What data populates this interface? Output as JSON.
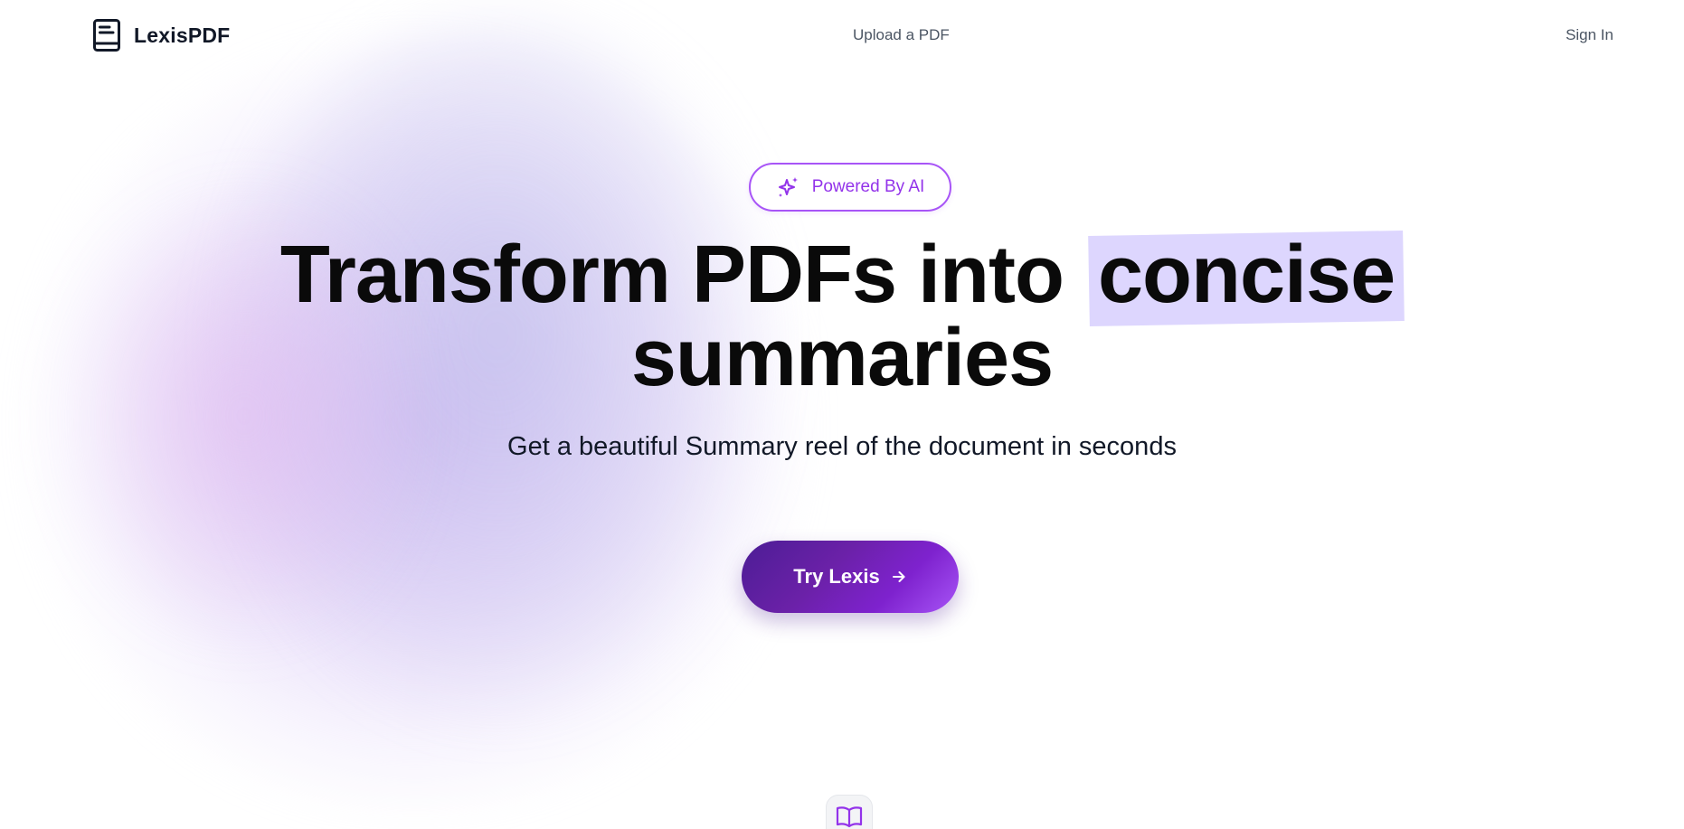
{
  "brand": {
    "name": "LexisPDF",
    "icon": "document-icon"
  },
  "nav": {
    "upload_label": "Upload a PDF",
    "signin_label": "Sign In"
  },
  "hero": {
    "badge_label": "Powered By AI",
    "badge_icon": "sparkles-icon",
    "headline_part1": "Transform PDFs into",
    "headline_highlight": "concise",
    "headline_part2": "summaries",
    "subtitle": "Get a beautiful Summary reel of the document in seconds",
    "cta_label": "Try Lexis",
    "cta_icon": "arrow-right-icon"
  },
  "footer_tile": {
    "icon": "book-open-icon"
  },
  "colors": {
    "accent": "#9333ea",
    "accent_dark": "#4c1d95",
    "highlight": "#ddd6fe",
    "text": "#0a0a0a",
    "muted": "#4b5563"
  }
}
